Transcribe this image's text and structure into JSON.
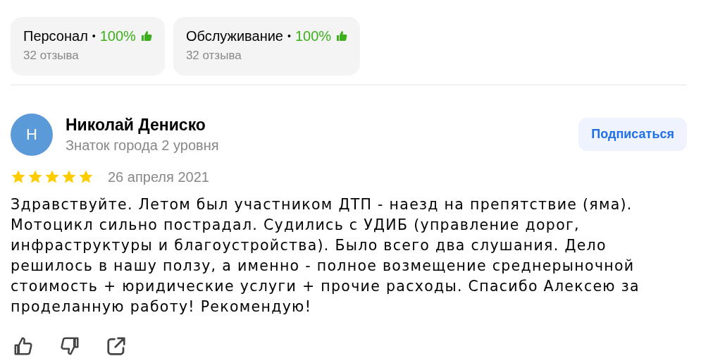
{
  "aspects": [
    {
      "name": "Персонал",
      "separator": "•",
      "percent": "100%",
      "count": "32 отзыва"
    },
    {
      "name": "Обслуживание",
      "separator": "•",
      "percent": "100%",
      "count": "32 отзыва"
    }
  ],
  "review": {
    "avatar_letter": "Н",
    "author": "Николай Дениско",
    "author_level": "Знаток города 2 уровня",
    "subscribe_button": "Подписаться",
    "stars": 5,
    "date": "26 апреля 2021",
    "text": "Здравствуйте. Летом был участником ДТП - наезд на препятствие (яма). Мотоцикл сильно пострадал. Судились с УДИБ (управление дорог, инфраструктуры и благоустройства). Было всего два слушания. Дело решилось в нашу ползу, а именно - полное возмещение среднерыночной стоимость + юридические услуги + прочие расходы. Спасибо Алексею за проделанную работу! Рекомендую!"
  }
}
